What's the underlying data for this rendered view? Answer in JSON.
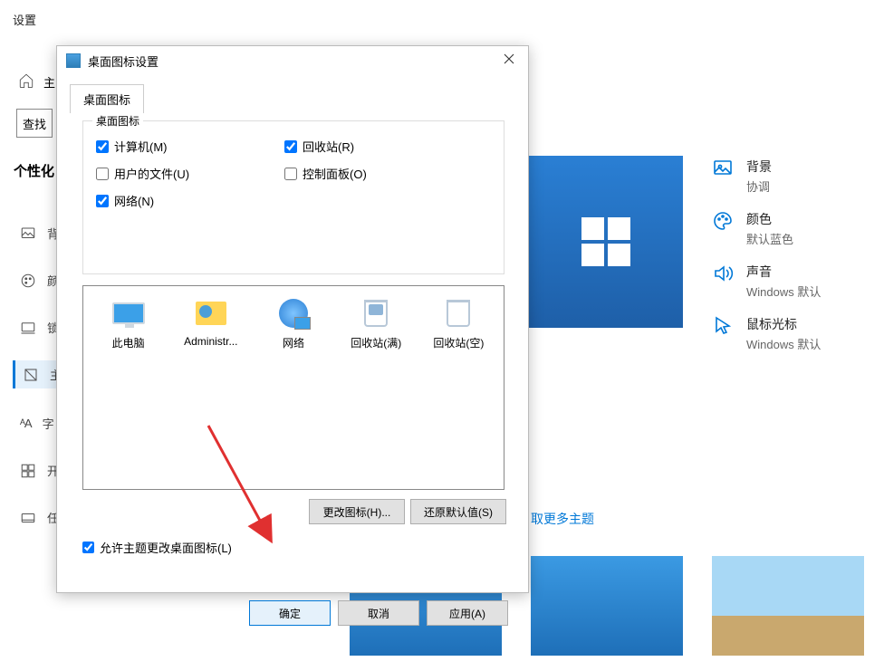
{
  "settings": {
    "title": "设置",
    "home": "主",
    "search": "查找",
    "category": "个性化",
    "nav": [
      "背",
      "颜",
      "锁",
      "主",
      "字",
      "开",
      "任"
    ],
    "options": {
      "background": {
        "title": "背景",
        "sub": "协调"
      },
      "color": {
        "title": "颜色",
        "sub": "默认蓝色"
      },
      "sound": {
        "title": "声音",
        "sub": "Windows  默认"
      },
      "cursor": {
        "title": "鼠标光标",
        "sub": "Windows  默认"
      }
    },
    "more_themes": "取更多主题"
  },
  "dialog": {
    "title": "桌面图标设置",
    "tab": "桌面图标",
    "group_label": "桌面图标",
    "checkboxes": {
      "computer": {
        "label": "计算机(M)",
        "checked": true
      },
      "recycle": {
        "label": "回收站(R)",
        "checked": true
      },
      "userfiles": {
        "label": "用户的文件(U)",
        "checked": false
      },
      "controlpanel": {
        "label": "控制面板(O)",
        "checked": false
      },
      "network": {
        "label": "网络(N)",
        "checked": true
      }
    },
    "icons": {
      "pc": "此电脑",
      "admin": "Administr...",
      "network": "网络",
      "bin_full": "回收站(满)",
      "bin_empty": "回收站(空)"
    },
    "change_icon": "更改图标(H)...",
    "restore_default": "还原默认值(S)",
    "allow_themes": {
      "label": "允许主题更改桌面图标(L)",
      "checked": true
    },
    "ok": "确定",
    "cancel": "取消",
    "apply": "应用(A)"
  }
}
